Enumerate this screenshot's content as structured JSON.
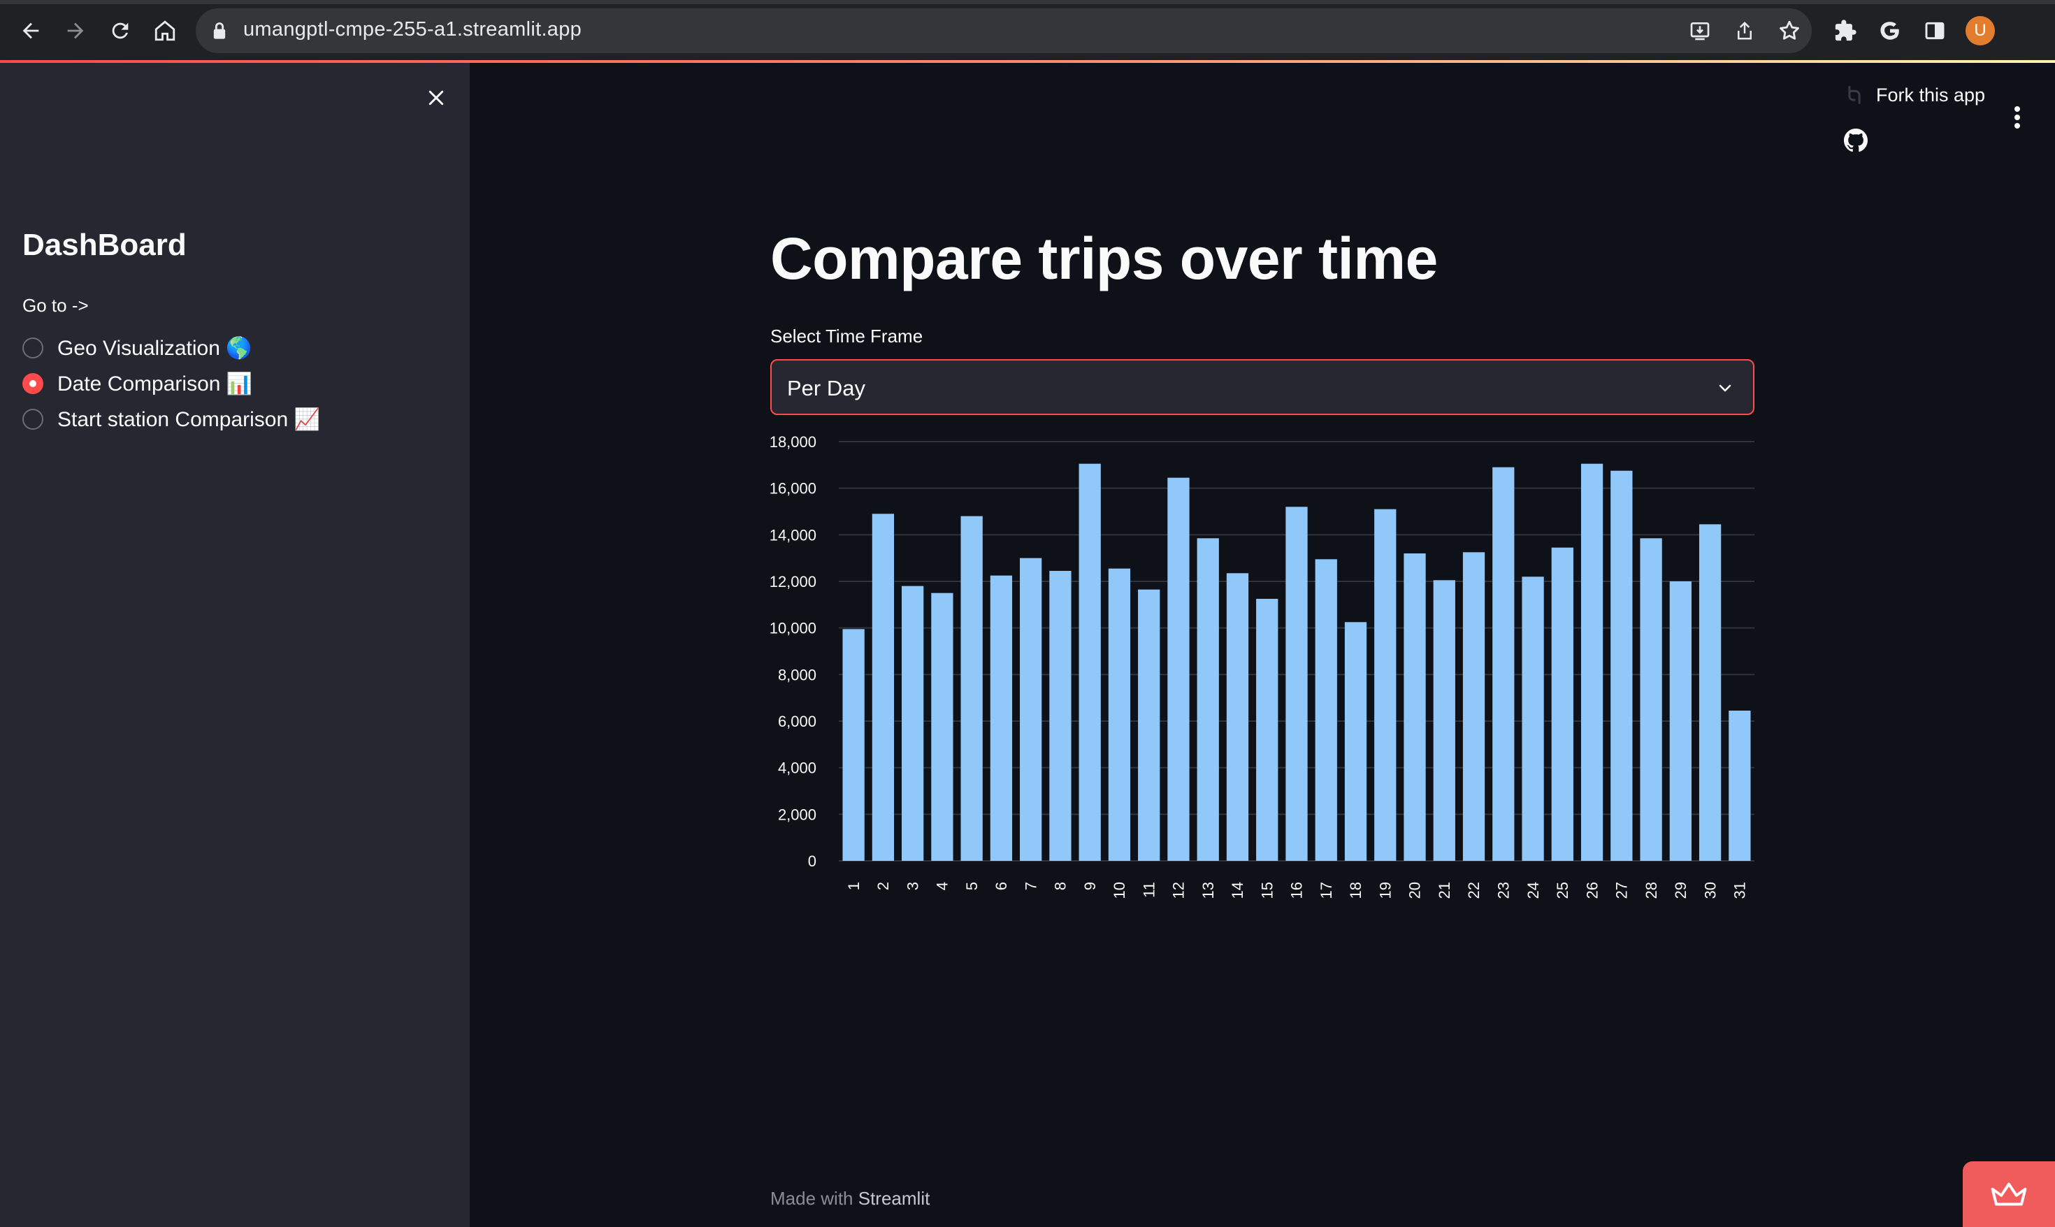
{
  "browser": {
    "url": "umangptl-cmpe-255-a1.streamlit.app",
    "profile_initial": "U",
    "icons": [
      "back-arrow-icon",
      "forward-arrow-icon",
      "reload-icon",
      "home-icon",
      "lock-icon",
      "install-icon",
      "share-icon",
      "star-icon",
      "extensions-icon",
      "google-icon",
      "side-panel-icon"
    ]
  },
  "sidebar": {
    "title": "DashBoard",
    "goto_label": "Go to ->",
    "options": [
      {
        "label": "Geo Visualization 🌎",
        "selected": false
      },
      {
        "label": "Date Comparison 📊",
        "selected": true
      },
      {
        "label": "Start station Comparison 📈",
        "selected": false
      }
    ]
  },
  "toolbar": {
    "fork_label": "Fork this app"
  },
  "main": {
    "title": "Compare trips over time",
    "select_label": "Select Time Frame",
    "select_value": "Per Day"
  },
  "footer": {
    "prefix": "Made with",
    "brand": "Streamlit"
  },
  "colors": {
    "accent": "#ff4b4b",
    "bar": "#90c8fa",
    "background": "#0e1117",
    "sidebar": "#262730"
  },
  "chart_data": {
    "type": "bar",
    "categories": [
      "1",
      "2",
      "3",
      "4",
      "5",
      "6",
      "7",
      "8",
      "9",
      "10",
      "11",
      "12",
      "13",
      "14",
      "15",
      "16",
      "17",
      "18",
      "19",
      "20",
      "21",
      "22",
      "23",
      "24",
      "25",
      "26",
      "27",
      "28",
      "29",
      "30",
      "31"
    ],
    "values": [
      9950,
      14900,
      11800,
      11500,
      14800,
      12250,
      13000,
      12450,
      17050,
      12550,
      11650,
      16450,
      13850,
      12350,
      11250,
      15200,
      12950,
      10250,
      15100,
      13200,
      12050,
      13250,
      16900,
      12200,
      13450,
      17050,
      16750,
      13850,
      12000,
      14450,
      6450
    ],
    "ylim": [
      0,
      18000
    ],
    "yticks": [
      0,
      2000,
      4000,
      6000,
      8000,
      10000,
      12000,
      14000,
      16000,
      18000
    ],
    "ytick_labels": [
      "0",
      "2,000",
      "4,000",
      "6,000",
      "8,000",
      "10,000",
      "12,000",
      "14,000",
      "16,000",
      "18,000"
    ],
    "xlabel": "",
    "ylabel": "",
    "grid": true
  }
}
